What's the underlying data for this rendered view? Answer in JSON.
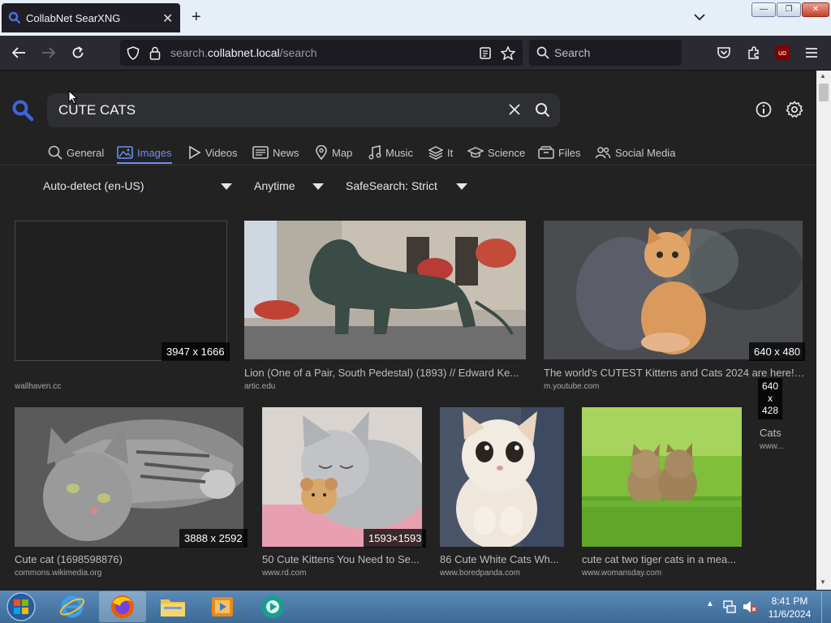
{
  "browser": {
    "tab_title": "CollabNet SearXNG",
    "url_prefix": "search.",
    "url_domain": "collabnet.local",
    "url_path": "/search",
    "search_placeholder": "Search",
    "ext_badge": "uo"
  },
  "search": {
    "query": "CUTE CATS",
    "categories": [
      {
        "label": "General"
      },
      {
        "label": "Images"
      },
      {
        "label": "Videos"
      },
      {
        "label": "News"
      },
      {
        "label": "Map"
      },
      {
        "label": "Music"
      },
      {
        "label": "It"
      },
      {
        "label": "Science"
      },
      {
        "label": "Files"
      },
      {
        "label": "Social Media"
      }
    ],
    "filters": {
      "language": "Auto-detect (en-US)",
      "time": "Anytime",
      "safesearch": "SafeSearch: Strict"
    }
  },
  "results": [
    {
      "dims": "3947 x 1666",
      "title": "",
      "source": "wallhaven.cc"
    },
    {
      "dims": "",
      "title": "Lion (One of a Pair, South Pedestal) (1893) // Edward Ke...",
      "source": "artic.edu"
    },
    {
      "dims": "640 x 480",
      "title": "The world's CUTEST Kittens and Cats 2024 are here! ...",
      "source": "m.youtube.com"
    },
    {
      "dims": "640\nx\n428",
      "title": "Cats",
      "source": "www..."
    },
    {
      "dims": "3888 x 2592",
      "title": "Cute cat (1698598876)",
      "source": "commons.wikimedia.org"
    },
    {
      "dims": "1593×1593",
      "title": "50 Cute Kittens You Need to Se...",
      "source": "www.rd.com"
    },
    {
      "dims": "",
      "title": "86 Cute White Cats Wh...",
      "source": "www.boredpanda.com"
    },
    {
      "dims": "",
      "title": "cute cat two tiger cats in a mea...",
      "source": "www.womansday.com"
    }
  ],
  "taskbar": {
    "time": "8:41 PM",
    "date": "11/6/2024"
  },
  "colors": {
    "accent": "#6d8ff5",
    "page_bg": "#222223",
    "search_bg": "#2e2f33"
  }
}
